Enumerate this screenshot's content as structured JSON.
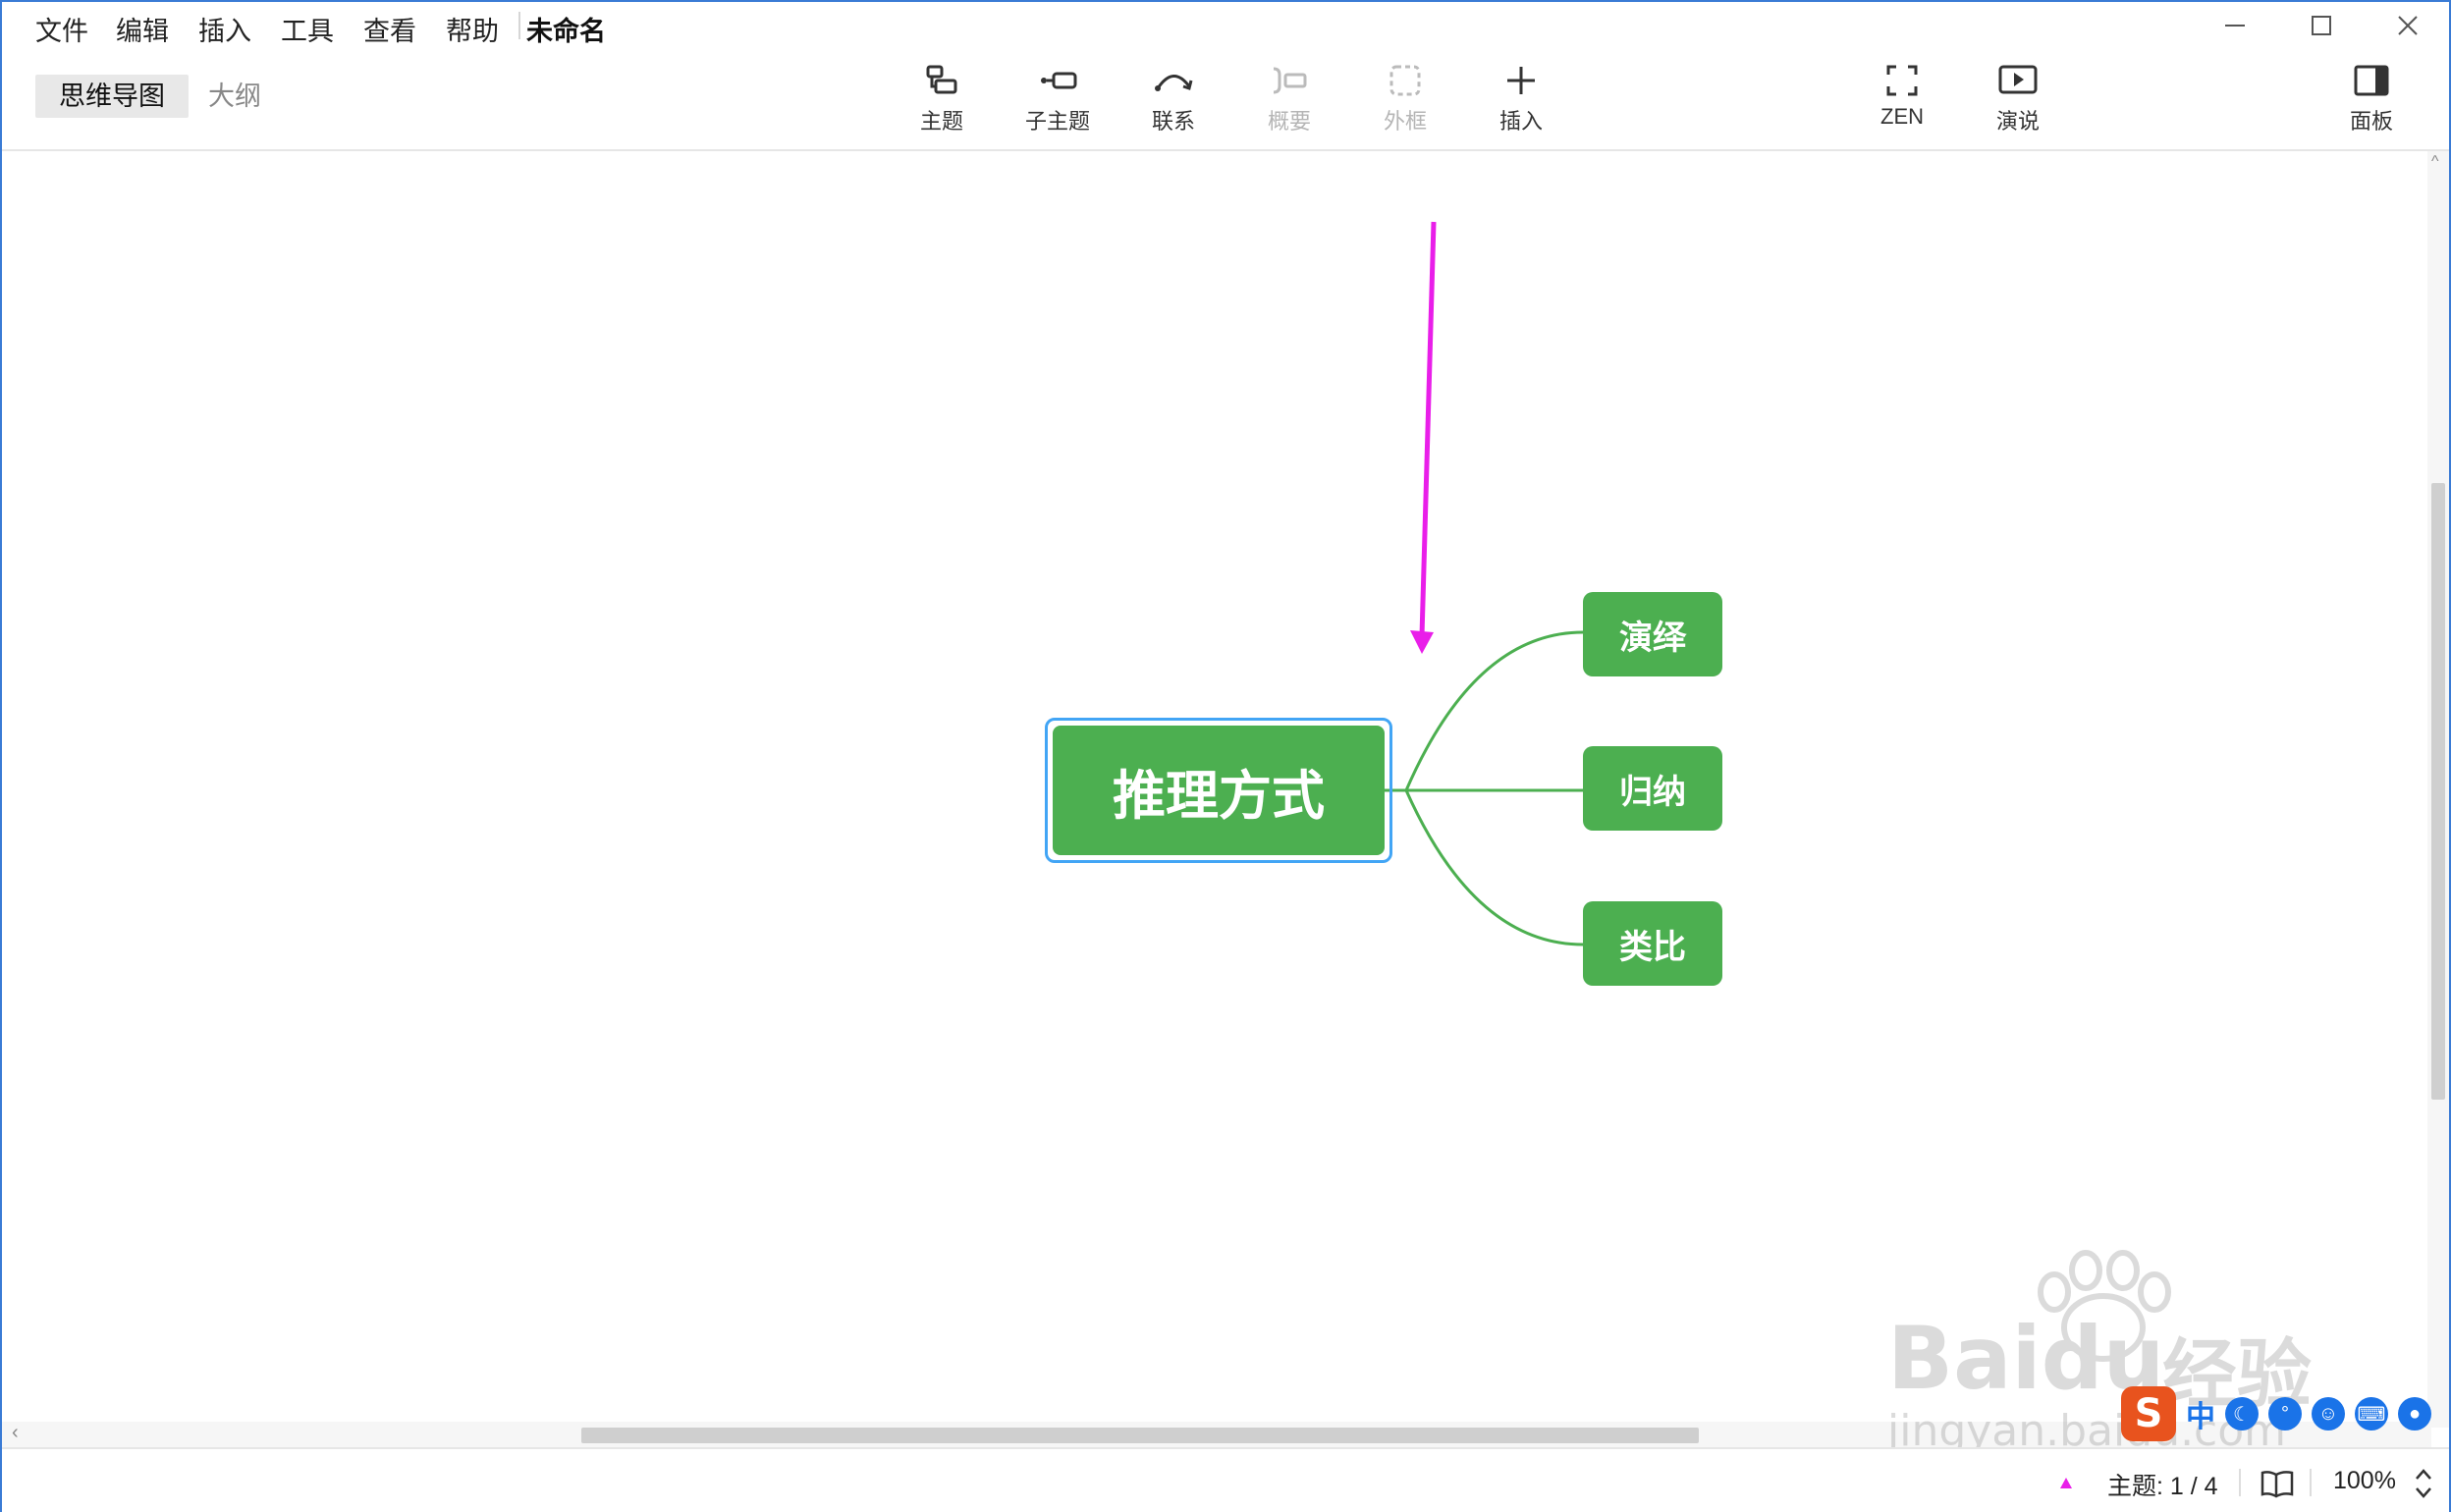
{
  "menu": {
    "items": [
      "文件",
      "编辑",
      "插入",
      "工具",
      "查看",
      "帮助"
    ],
    "doc_title": "未命名"
  },
  "window_controls": {
    "minimize": "—",
    "maximize": "☐",
    "close": "✕"
  },
  "view_tabs": {
    "mindmap": "思维导图",
    "outline": "大纲"
  },
  "toolbar": {
    "topic": "主题",
    "subtopic": "子主题",
    "relationship": "联系",
    "summary": "概要",
    "boundary": "外框",
    "insert": "插入",
    "zen": "ZEN",
    "present": "演说",
    "panel": "面板"
  },
  "mindmap": {
    "root": "推理方式",
    "children": [
      "演绎",
      "归纳",
      "类比"
    ],
    "node_color": "#4caf50",
    "selection_color": "#42a5f5",
    "arrow_color": "#e91ee9"
  },
  "status": {
    "topic_count": "主题: 1 / 4",
    "zoom": "100%"
  },
  "watermark": {
    "brand": "Baidu",
    "brand_cn": "经验",
    "url": "jingyan.baidu.com"
  },
  "ime": {
    "logo": "S",
    "mode": "中"
  }
}
